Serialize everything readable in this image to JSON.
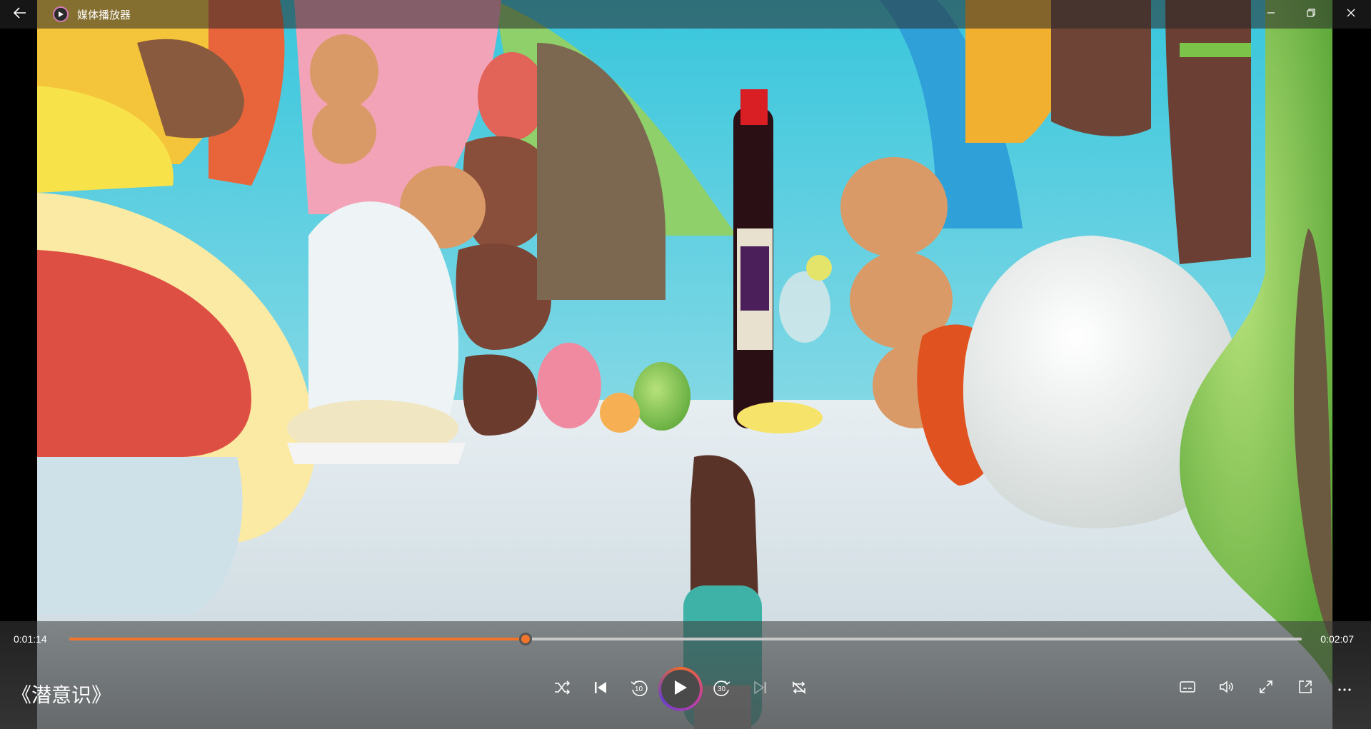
{
  "window": {
    "title": "媒体播放器"
  },
  "player": {
    "media_title": "《潜意识》",
    "current_time": "0:01:14",
    "total_time": "0:02:07",
    "progress": 0.37,
    "skip_back_seconds": "10",
    "skip_forward_seconds": "30"
  },
  "colors": {
    "accent": "#f0752a",
    "label_text": "#ffffff"
  },
  "icons": {
    "back": "back-arrow-icon",
    "app": "media-player-app-icon",
    "minimize": "minimize-icon",
    "restore": "restore-icon",
    "close": "close-icon",
    "shuffle": "shuffle-icon",
    "previous": "previous-track-icon",
    "skip_back": "skip-back-10-icon",
    "play": "play-icon",
    "skip_forward": "skip-forward-30-icon",
    "next": "next-track-icon",
    "repeat": "repeat-icon",
    "subtitles": "subtitles-icon",
    "volume": "volume-icon",
    "fullscreen": "fullscreen-icon",
    "mini_player": "mini-player-icon",
    "more": "more-options-icon"
  }
}
